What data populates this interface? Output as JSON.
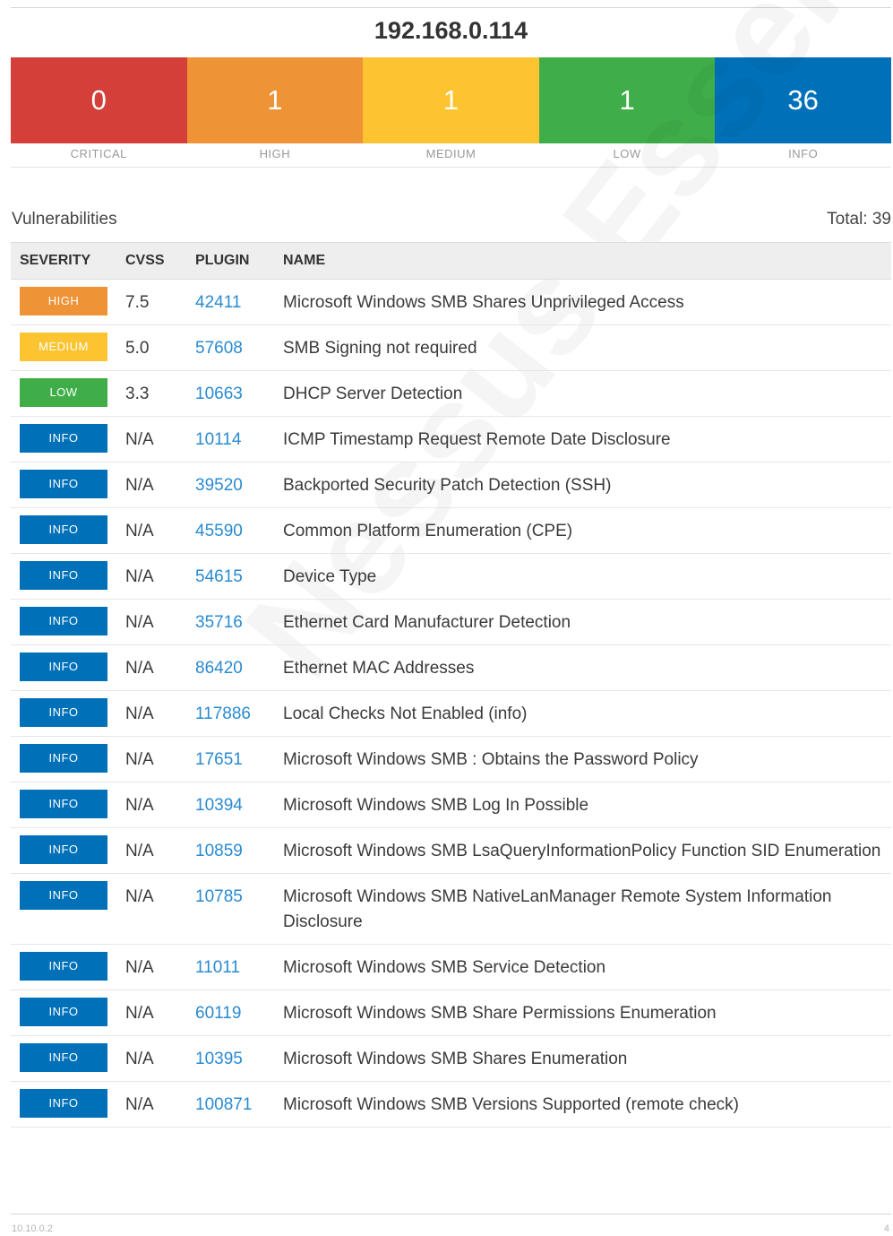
{
  "host": "192.168.0.114",
  "summary": [
    {
      "count": "0",
      "label": "CRITICAL",
      "color": "#d43f3a"
    },
    {
      "count": "1",
      "label": "HIGH",
      "color": "#ee9336"
    },
    {
      "count": "1",
      "label": "MEDIUM",
      "color": "#fdc431"
    },
    {
      "count": "1",
      "label": "LOW",
      "color": "#3fae49"
    },
    {
      "count": "36",
      "label": "INFO",
      "color": "#0071b9"
    }
  ],
  "section_title": "Vulnerabilities",
  "total_text": "Total: 39",
  "columns": [
    "SEVERITY",
    "CVSS",
    "PLUGIN",
    "NAME"
  ],
  "severity_colors": {
    "HIGH": "#ee9336",
    "MEDIUM": "#fdc431",
    "LOW": "#3fae49",
    "INFO": "#0071b9"
  },
  "rows": [
    {
      "severity": "HIGH",
      "cvss": "7.5",
      "plugin": "42411",
      "name": "Microsoft Windows SMB Shares Unprivileged Access"
    },
    {
      "severity": "MEDIUM",
      "cvss": "5.0",
      "plugin": "57608",
      "name": "SMB Signing not required"
    },
    {
      "severity": "LOW",
      "cvss": "3.3",
      "plugin": "10663",
      "name": "DHCP Server Detection"
    },
    {
      "severity": "INFO",
      "cvss": "N/A",
      "plugin": "10114",
      "name": "ICMP Timestamp Request Remote Date Disclosure"
    },
    {
      "severity": "INFO",
      "cvss": "N/A",
      "plugin": "39520",
      "name": "Backported Security Patch Detection (SSH)"
    },
    {
      "severity": "INFO",
      "cvss": "N/A",
      "plugin": "45590",
      "name": "Common Platform Enumeration (CPE)"
    },
    {
      "severity": "INFO",
      "cvss": "N/A",
      "plugin": "54615",
      "name": "Device Type"
    },
    {
      "severity": "INFO",
      "cvss": "N/A",
      "plugin": "35716",
      "name": "Ethernet Card Manufacturer Detection"
    },
    {
      "severity": "INFO",
      "cvss": "N/A",
      "plugin": "86420",
      "name": "Ethernet MAC Addresses"
    },
    {
      "severity": "INFO",
      "cvss": "N/A",
      "plugin": "117886",
      "name": "Local Checks Not Enabled (info)"
    },
    {
      "severity": "INFO",
      "cvss": "N/A",
      "plugin": "17651",
      "name": "Microsoft Windows SMB : Obtains the Password Policy"
    },
    {
      "severity": "INFO",
      "cvss": "N/A",
      "plugin": "10394",
      "name": "Microsoft Windows SMB Log In Possible"
    },
    {
      "severity": "INFO",
      "cvss": "N/A",
      "plugin": "10859",
      "name": "Microsoft Windows SMB LsaQueryInformationPolicy Function SID Enumeration"
    },
    {
      "severity": "INFO",
      "cvss": "N/A",
      "plugin": "10785",
      "name": "Microsoft Windows SMB NativeLanManager Remote System Information Disclosure"
    },
    {
      "severity": "INFO",
      "cvss": "N/A",
      "plugin": "11011",
      "name": "Microsoft Windows SMB Service Detection"
    },
    {
      "severity": "INFO",
      "cvss": "N/A",
      "plugin": "60119",
      "name": "Microsoft Windows SMB Share Permissions Enumeration"
    },
    {
      "severity": "INFO",
      "cvss": "N/A",
      "plugin": "10395",
      "name": "Microsoft Windows SMB Shares Enumeration"
    },
    {
      "severity": "INFO",
      "cvss": "N/A",
      "plugin": "100871",
      "name": "Microsoft Windows SMB Versions Supported (remote check)"
    }
  ],
  "watermark": "Nessus Essentials",
  "footer": {
    "left": "10.10.0.2",
    "right": "4"
  }
}
